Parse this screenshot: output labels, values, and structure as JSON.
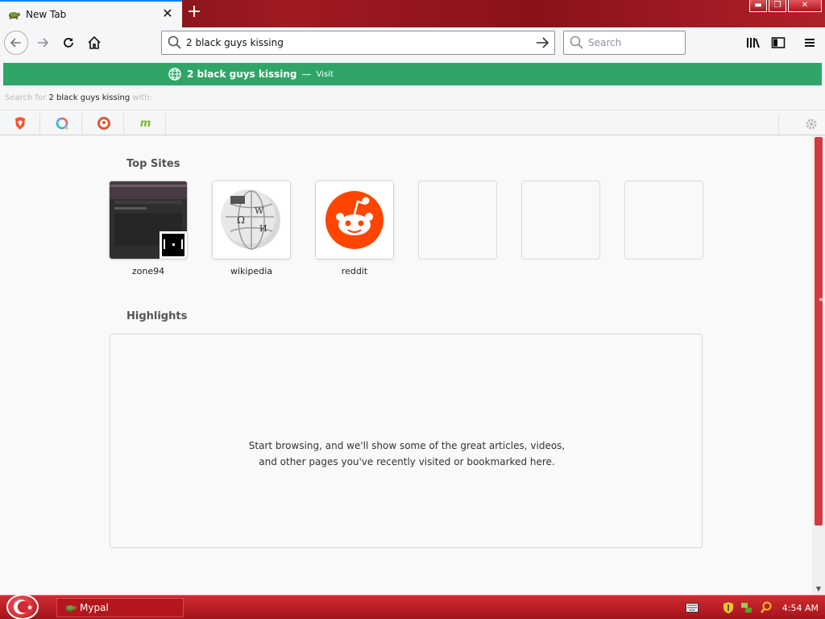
{
  "tab": {
    "title": "New Tab",
    "favicon": "turtle-icon"
  },
  "urlbar": {
    "value": "2 black guys kissing"
  },
  "searchbar": {
    "placeholder": "Search"
  },
  "autocomplete": {
    "text": "2 black guys kissing",
    "separator": "—",
    "action": "Visit",
    "accent": "#30a568",
    "search_for_label": "Search for",
    "search_with_label": "with:",
    "engines": [
      "brave-icon",
      "qwant-icon",
      "duckduckgo-icon",
      "mojeek-icon"
    ]
  },
  "top_sites": {
    "title": "Top Sites",
    "sites": [
      {
        "label": "zone94"
      },
      {
        "label": "wikipedia"
      },
      {
        "label": "reddit"
      },
      {
        "label": ""
      },
      {
        "label": ""
      },
      {
        "label": ""
      }
    ]
  },
  "highlights": {
    "title": "Highlights",
    "message": "Start browsing, and we'll show some of the great articles, videos, and other pages you've recently visited or bookmarked here."
  },
  "taskbar": {
    "task_label": "Mypal",
    "clock": "4:54 AM"
  },
  "theme": {
    "frame": "#a01a22",
    "scroll_thumb": "#d33a40"
  }
}
